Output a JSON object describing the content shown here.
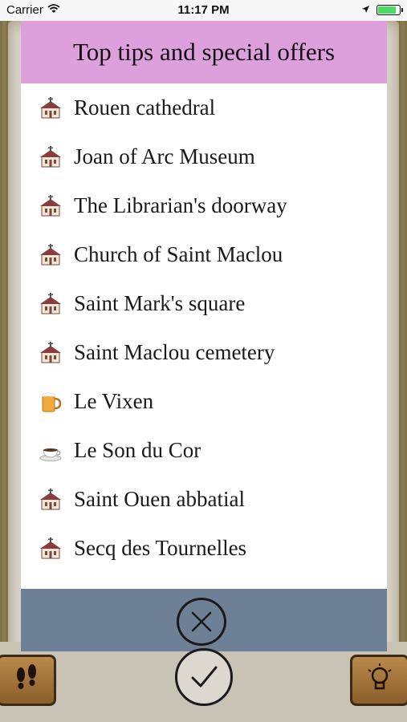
{
  "status_bar": {
    "carrier": "Carrier",
    "time": "11:17 PM"
  },
  "modal": {
    "title": "Top tips and special offers",
    "items": [
      {
        "label": "Rouen cathedral",
        "icon": "church-icon"
      },
      {
        "label": "Joan of Arc Museum",
        "icon": "church-icon"
      },
      {
        "label": "The Librarian's doorway",
        "icon": "church-icon"
      },
      {
        "label": "Church of Saint Maclou",
        "icon": "church-icon"
      },
      {
        "label": "Saint Mark's square",
        "icon": "church-icon"
      },
      {
        "label": "Saint Maclou cemetery",
        "icon": "church-icon"
      },
      {
        "label": "Le Vixen",
        "icon": "beer-mug-icon"
      },
      {
        "label": "Le Son du Cor",
        "icon": "coffee-cup-icon"
      },
      {
        "label": "Saint Ouen abbatial",
        "icon": "church-icon"
      },
      {
        "label": "Secq des Tournelles",
        "icon": "church-icon"
      }
    ]
  },
  "colors": {
    "header_bg": "#dda0dd",
    "footer_bg": "#6e8096",
    "battery_fill": "#4cd964"
  }
}
